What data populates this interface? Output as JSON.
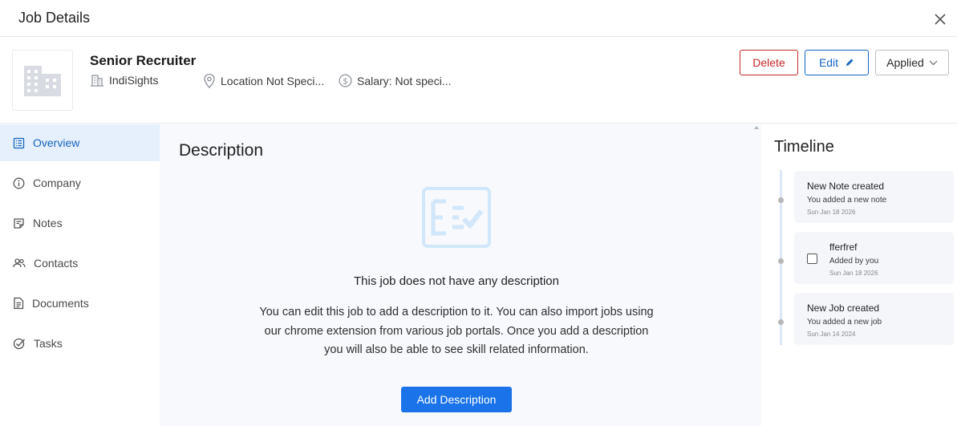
{
  "header": {
    "title": "Job Details"
  },
  "job": {
    "title": "Senior Recruiter",
    "company": "IndiSights",
    "location": "Location Not Speci...",
    "salary": "Salary: Not speci..."
  },
  "actions": {
    "delete_label": "Delete",
    "edit_label": "Edit",
    "status_value": "Applied"
  },
  "sidebar": {
    "items": [
      {
        "label": "Overview",
        "icon": "overview-icon",
        "active": true
      },
      {
        "label": "Company",
        "icon": "info-icon"
      },
      {
        "label": "Notes",
        "icon": "notes-icon"
      },
      {
        "label": "Contacts",
        "icon": "contacts-icon"
      },
      {
        "label": "Documents",
        "icon": "document-icon"
      },
      {
        "label": "Tasks",
        "icon": "tasks-icon"
      }
    ]
  },
  "description": {
    "heading": "Description",
    "empty_title": "This job does not have any description",
    "empty_text": "You can edit this job to add a description to it. You can also import jobs using our chrome extension from various job portals. Once you add a description you will also be able to see skill related information.",
    "add_button": "Add Description"
  },
  "timeline": {
    "heading": "Timeline",
    "events": [
      {
        "title": "New Note created",
        "subtitle": "You added a new note",
        "date": "Sun Jan 18 2026"
      },
      {
        "title": "fferfref",
        "subtitle": "Added by you",
        "date": "Sun Jan 18 2026",
        "type": "task"
      },
      {
        "title": "New Job created",
        "subtitle": "You added a new job",
        "date": "Sun Jan 14 2024"
      }
    ]
  },
  "colors": {
    "accent": "#1a73e8",
    "danger": "#c62828",
    "active_nav_bg": "#e6effc"
  }
}
